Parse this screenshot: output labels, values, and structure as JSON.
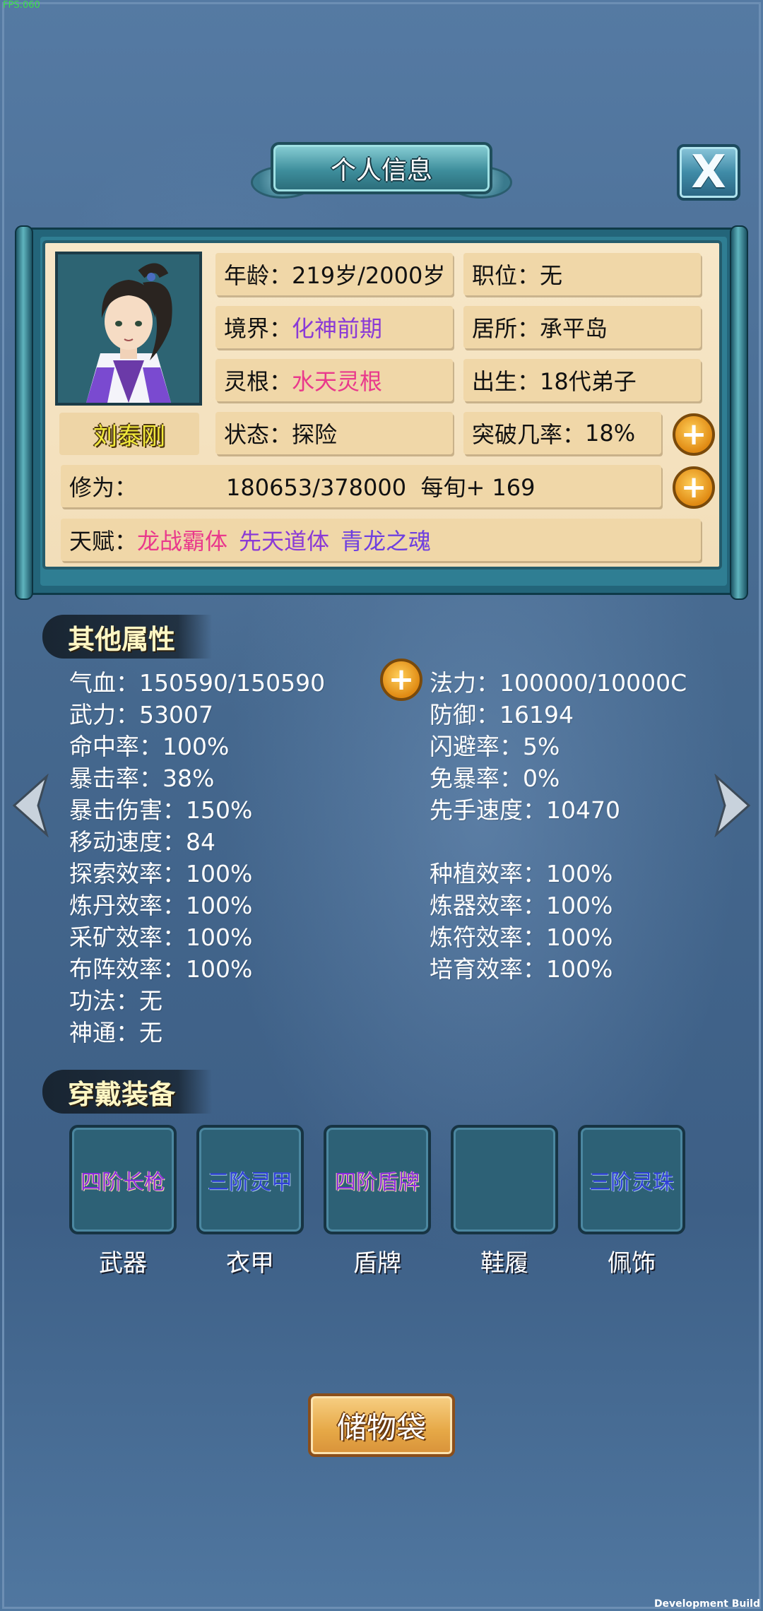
{
  "debug": {
    "fps": "FPS:060",
    "build": "Development Build"
  },
  "header": {
    "title": "个人信息",
    "close_label": "X"
  },
  "profile": {
    "name": "刘泰刚",
    "fields": {
      "age": {
        "label": "年龄：",
        "value": "219岁/2000岁"
      },
      "position": {
        "label": "职位：",
        "value": "无"
      },
      "realm": {
        "label": "境界：",
        "value": "化神前期"
      },
      "residence": {
        "label": "居所：",
        "value": "承平岛"
      },
      "spirit_root": {
        "label": "灵根：",
        "value": "水天灵根"
      },
      "origin": {
        "label": "出生：",
        "value": "18代弟子"
      },
      "state": {
        "label": "状态：",
        "value": "探险"
      },
      "breakthrough": {
        "label": "突破几率：",
        "value": "18%"
      },
      "cultivation": {
        "label": "修为：",
        "value": "180653/378000  每旬+ 169"
      },
      "talent": {
        "label": "天赋：",
        "items": [
          "龙战霸体",
          "先天道体",
          "青龙之魂"
        ]
      }
    },
    "plus_icon": "+"
  },
  "other_attributes": {
    "title": "其他属性",
    "left": [
      "气血：150590/150590",
      "武力：53007",
      "命中率：100%",
      "暴击率：38%",
      "暴击伤害：150%",
      "移动速度：84",
      "探索效率：100%",
      "炼丹效率：100%",
      "采矿效率：100%",
      "布阵效率：100%",
      "功法：无",
      "神通：无"
    ],
    "right": [
      "法力：100000/10000C",
      "防御：16194",
      "闪避率：5%",
      "免暴率：0%",
      "先手速度：10470",
      "种植效率：100%",
      "炼器效率：100%",
      "炼符效率：100%",
      "培育效率：100%"
    ]
  },
  "equipment": {
    "title": "穿戴装备",
    "slots": [
      {
        "label": "武器",
        "item": "四阶长枪"
      },
      {
        "label": "衣甲",
        "item": "三阶灵甲"
      },
      {
        "label": "盾牌",
        "item": "四阶盾牌"
      },
      {
        "label": "鞋履",
        "item": ""
      },
      {
        "label": "佩饰",
        "item": "三阶灵珠"
      }
    ]
  },
  "footer": {
    "bag_label": "储物袋"
  },
  "icons": [
    "chevron-left-icon",
    "chevron-right-icon",
    "plus-icon",
    "close-icon",
    "character-portrait"
  ],
  "colors": {
    "talent_pink": "#e9398c",
    "talent_purple": "#8a3ad6",
    "gold": "#f2ea3a"
  }
}
